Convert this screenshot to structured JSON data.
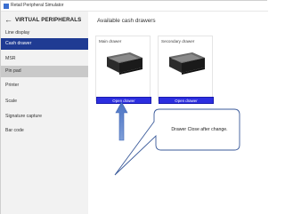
{
  "window": {
    "title": "Retail Peripheral Simulator"
  },
  "sidebar": {
    "back_icon": "←",
    "title": "VIRTUAL PERIPHERALS",
    "items": [
      {
        "label": "Line display"
      },
      {
        "label": "Cash drawer"
      },
      {
        "label": "MSR"
      },
      {
        "label": "Pin pad"
      },
      {
        "label": "Printer"
      },
      {
        "label": "Scale"
      },
      {
        "label": "Signature capture"
      },
      {
        "label": "Bar code"
      }
    ]
  },
  "main": {
    "title": "Available cash drawers",
    "drawers": [
      {
        "label": "Main drawer",
        "button": "Open drawer"
      },
      {
        "label": "Secondary drawer",
        "button": "Open drawer"
      }
    ]
  },
  "annotation": {
    "text": "Drawer Close after change."
  },
  "colors": {
    "selected": "#1f3b93",
    "button": "#2c2ee0",
    "arrow": "#4b73c4",
    "callout_border": "#3a5a9a"
  }
}
